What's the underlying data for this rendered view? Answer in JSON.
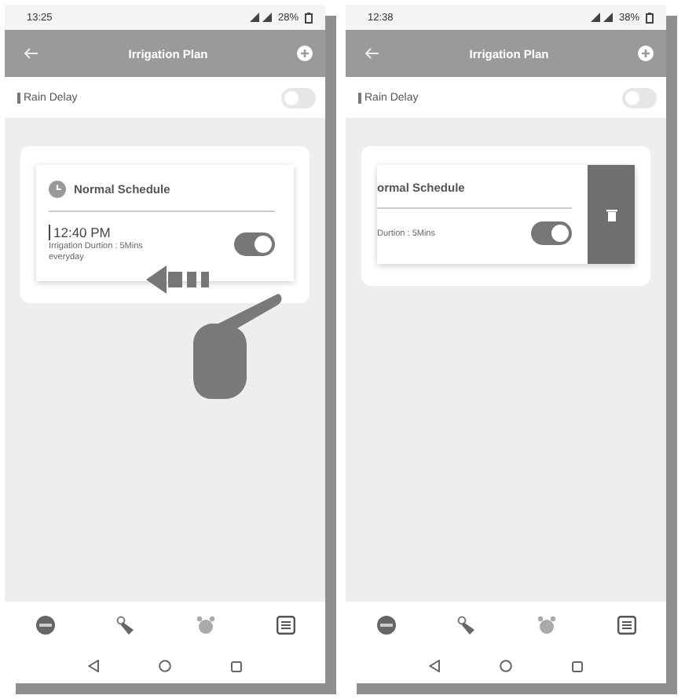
{
  "screens": [
    {
      "status_bar": {
        "time": "13:25",
        "battery": "28%"
      },
      "header": {
        "title": "Irrigation Plan"
      },
      "rain_delay": {
        "label": "Rain Delay",
        "on": false
      },
      "schedule": {
        "title": "Normal Schedule",
        "time": "12:40 PM",
        "duration": "Irrigation Durtion : 5Mins",
        "repeat": "everyday",
        "enabled": true,
        "swiped": false
      },
      "swipe_hint": true
    },
    {
      "status_bar": {
        "time": "12:38",
        "battery": "38%"
      },
      "header": {
        "title": "Irrigation Plan"
      },
      "rain_delay": {
        "label": "Rain Delay",
        "on": false
      },
      "schedule": {
        "title": "ormal Schedule",
        "duration": "Durtion : 5Mins",
        "enabled": true,
        "swiped": true
      },
      "swipe_hint": false
    }
  ]
}
